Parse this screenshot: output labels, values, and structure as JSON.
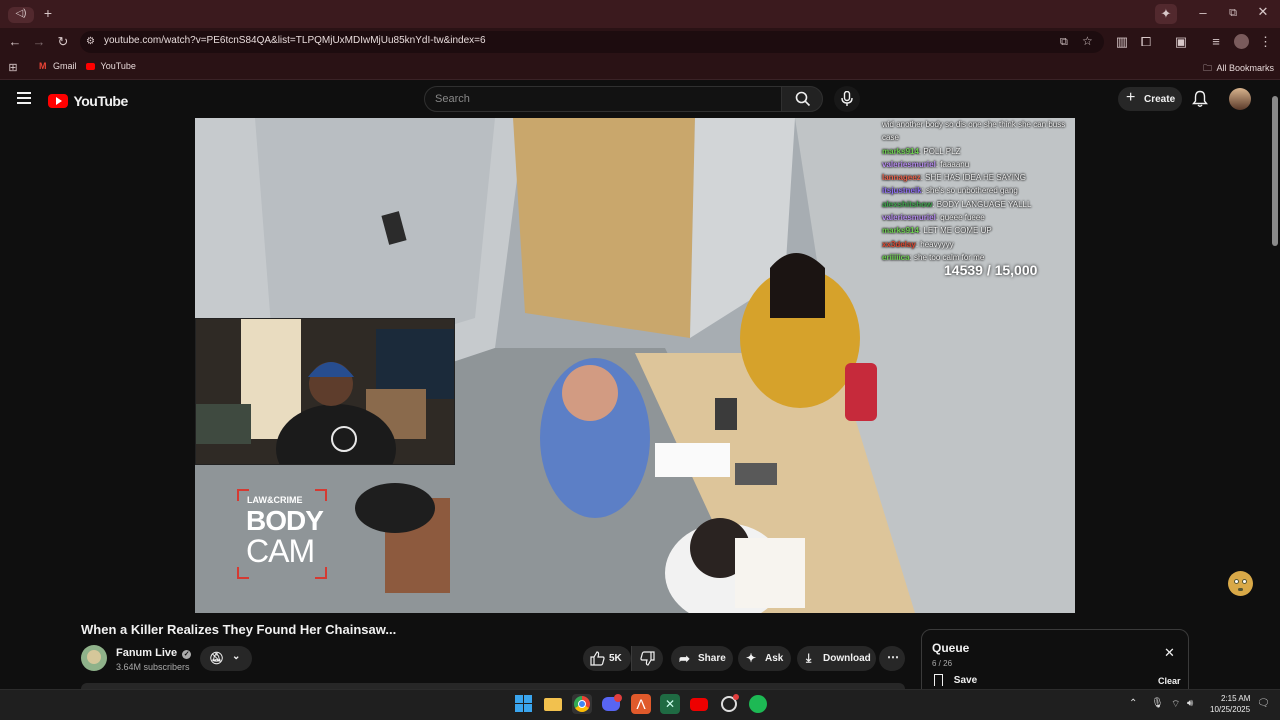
{
  "browser": {
    "url": "youtube.com/watch?v=PE6tcnS84QA&list=TLPQMjUxMDIwMjUu85knYdI-tw&index=6",
    "bookmarks": [
      {
        "label": "Gmail"
      },
      {
        "label": "YouTube"
      }
    ],
    "all_bookmarks_label": "All Bookmarks",
    "accent_color": "#3b1a1e"
  },
  "youtube": {
    "logo_text": "YouTube",
    "search_placeholder": "Search",
    "create_label": "Create"
  },
  "video": {
    "chat": [
      {
        "user": "",
        "text": "wid another body so dis one she think she can buss case",
        "color": "#ffffff"
      },
      {
        "user": "marks914",
        "text": "POLL  PLZ",
        "color": "#6fcf52"
      },
      {
        "user": "valeriesmuriel",
        "text": "faaaanu",
        "color": "#b78cf0"
      },
      {
        "user": "lannageez",
        "text": "SHE HAS  IDEA  HE SAYING",
        "color": "#e7624c"
      },
      {
        "user": "itsjustneik",
        "text": "she's so unbothered gang",
        "color": "#8d6cf0"
      },
      {
        "user": "alexshitshow",
        "text": "BODY LANGUAGE YALLL",
        "color": "#3fa34d"
      },
      {
        "user": "valeriesmuriel",
        "text": "queee fueee",
        "color": "#b78cf0"
      },
      {
        "user": "marks914",
        "text": "LET ME COME UP",
        "color": "#6fcf52"
      },
      {
        "user": "xx3delay",
        "text": "heavyyyy",
        "color": "#d9472f"
      },
      {
        "user": "eriiiiica",
        "text": "she too calm for me",
        "color": "#6fcf52"
      }
    ],
    "goal_counter": "14539 / 15,000",
    "badge": {
      "line1": "LAW&CRIME",
      "line2": "BODY",
      "line3": "CAM"
    }
  },
  "watch": {
    "title": "When a Killer Realizes They Found Her Chainsaw...",
    "channel": "Fanum Live",
    "subscribers": "3.64M subscribers",
    "like_count": "5K",
    "share_label": "Share",
    "ask_label": "Ask",
    "download_label": "Download"
  },
  "queue": {
    "title": "Queue",
    "position": "6 / 26",
    "save_label": "Save",
    "clear_label": "Clear"
  },
  "taskbar": {
    "time": "2:15 AM",
    "date": "10/25/2025"
  }
}
